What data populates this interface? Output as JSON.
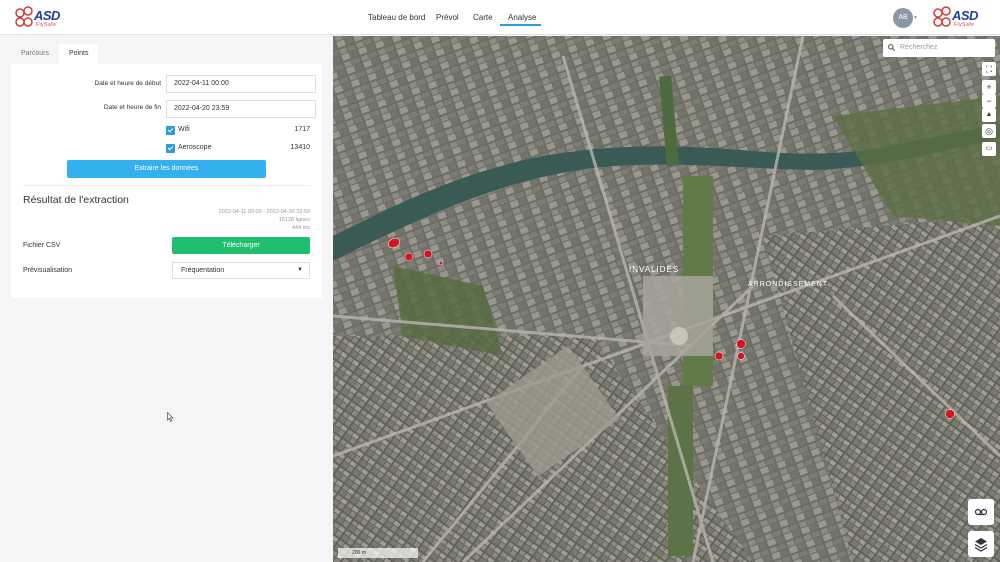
{
  "brand": {
    "name": "ASD",
    "tagline": "FlySafe"
  },
  "nav": {
    "items": [
      {
        "label": "Tableau de bord"
      },
      {
        "label": "Prévol"
      },
      {
        "label": "Carte"
      },
      {
        "label": "Analyse",
        "active": true
      }
    ]
  },
  "user": {
    "initials": "AB"
  },
  "tabs": [
    {
      "label": "Parcours",
      "active": false
    },
    {
      "label": "Points",
      "active": true
    }
  ],
  "form": {
    "start_label": "Date et heure de début",
    "start_value": "2022-04-11 00:00",
    "end_label": "Date et heure de fin",
    "end_value": "2022-04-20 23:59",
    "sources": [
      {
        "label": "Wifi",
        "checked": true,
        "count": "1717"
      },
      {
        "label": "Aeroscope",
        "checked": true,
        "count": "13410"
      }
    ],
    "extract_button": "Extraire les données"
  },
  "result": {
    "title": "Résultat de l'extraction",
    "range": "2022-04-11 00:00 - 2022-04-20 23:59",
    "lines": "15128 lignes",
    "duration": "444 ms",
    "csv_label": "Fichier CSV",
    "download_button": "Télécharger",
    "preview_label": "Prévisualisation",
    "preview_value": "Fréquentation"
  },
  "map": {
    "search_placeholder": "Recherchez",
    "scale": "200 m",
    "labels": {
      "invalides": "INVALIDES",
      "arrondissement": "ARRONDISSEMENT"
    }
  },
  "colors": {
    "accent": "#2d9bd8",
    "extract_button": "#34b0ef",
    "download_button": "#1fbf6f",
    "point_marker": "#d41420"
  },
  "icons": [
    "search-icon",
    "fullscreen-icon",
    "zoom-in-icon",
    "zoom-out-icon",
    "compass-icon",
    "locate-icon",
    "ruler-icon",
    "street-view-icon",
    "layers-icon",
    "chevron-down-icon"
  ]
}
